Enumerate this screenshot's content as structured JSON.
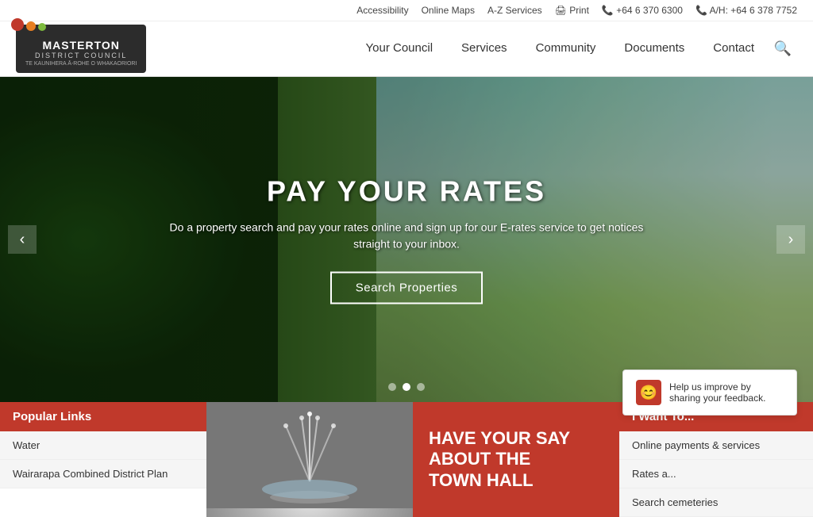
{
  "utilityBar": {
    "accessibility": "Accessibility",
    "onlineMaps": "Online Maps",
    "azServices": "A-Z Services",
    "print": "Print",
    "phone1Label": "+64 6 370 6300",
    "phone2Label": "A/H: +64 6 378 7752"
  },
  "logo": {
    "masterton": "MASTERTON",
    "district": "DISTRICT COUNCIL",
    "maori": "TE KAUNIHERA Ā-ROHE O WHAKAORIORI"
  },
  "nav": {
    "yourCouncil": "Your Council",
    "services": "Services",
    "community": "Community",
    "documents": "Documents",
    "contact": "Contact"
  },
  "hero": {
    "title": "PAY YOUR RATES",
    "subtitle": "Do a property search and pay your rates online and sign up for our E-rates service to get notices straight to your inbox.",
    "btnLabel": "Search Properties"
  },
  "popularLinks": {
    "heading": "Popular Links",
    "items": [
      {
        "label": "Water"
      },
      {
        "label": "Wairarapa Combined District Plan"
      }
    ]
  },
  "haveSay": {
    "line1": "HAVE YOUR SAY",
    "line2": "ABOUT THE",
    "line3": "TOWN HALL"
  },
  "iWantTo": {
    "heading": "I Want To...",
    "items": [
      {
        "label": "Online payments & services"
      },
      {
        "label": "Rates a..."
      },
      {
        "label": "Search cemeteries"
      }
    ]
  },
  "feedback": {
    "text": "Help us improve by sharing your feedback."
  }
}
